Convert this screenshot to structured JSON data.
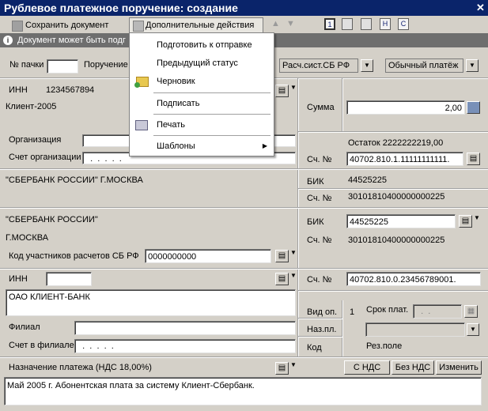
{
  "window": {
    "title": "Рублевое платежное поручение: создание",
    "close_glyph": "✕"
  },
  "toolbar": {
    "save_label": "Сохранить документ",
    "extra_label": "Дополнительные действия"
  },
  "info": {
    "text": "Документ может быть подг"
  },
  "menu": {
    "items": [
      "Подготовить к отправке",
      "Предыдущий статус",
      "Черновик",
      "Подписать",
      "Печать",
      "Шаблоны"
    ],
    "submenu_arrow": "▶"
  },
  "header": {
    "batch_label": "№ пачки",
    "batch_value": "",
    "order_label": "Поручение",
    "calc_system": "Расч.сист.СБ РФ",
    "payment_type": "Обычный платёж"
  },
  "payer": {
    "inn_label": "ИНН",
    "inn_value": "1234567894",
    "name": "Клиент-2005",
    "org_label": "Организация",
    "org_value": "",
    "account_label": "Счет организации",
    "account_value": "  .  .  .  .  ."
  },
  "amount": {
    "label": "Сумма",
    "value": "2,00"
  },
  "payer_account": {
    "label": "Сч. №",
    "balance": "Остаток 2222222219,00",
    "value": "40702.810.1.11111111111."
  },
  "payer_bank": {
    "name": "\"СБЕРБАНК РОССИИ\" Г.МОСКВА",
    "bik_label": "БИК",
    "bik_value": "44525225",
    "acc_label": "Сч. №",
    "acc_value": "30101810400000000225"
  },
  "payee_bank": {
    "name": "\"СБЕРБАНК РОССИИ\"",
    "city": "Г.МОСКВА",
    "code_label": "Код участников расчетов СБ РФ",
    "code_value": "0000000000",
    "bik_label": "БИК",
    "bik_value": "44525225",
    "acc_label": "Сч. №",
    "acc_value": "30101810400000000225"
  },
  "payee": {
    "inn_label": "ИНН",
    "inn_value": "",
    "acc_label": "Сч. №",
    "acc_value": "40702.810.0.23456789001.",
    "name": "ОАО КЛИЕНТ-БАНК",
    "branch_label": "Филиал",
    "branch_value": "",
    "branch_acc_label": "Счет в филиале",
    "branch_acc_value": "  .  .  .  .  ."
  },
  "op": {
    "type_label": "Вид оп.",
    "type_value": "1",
    "purpose_label": "Наз.пл.",
    "code_label": "Код",
    "term_label": "Срок плат.",
    "term_value": "  .  .",
    "res_label": "Рез.поле"
  },
  "purpose": {
    "label": "Назначение платежа (НДС 18,00%)",
    "btn_vat": "С НДС",
    "btn_novat": "Без НДС",
    "btn_change": "Изменить",
    "text": "Май 2005 г. Абонентская плата за систему Клиент-Сбербанк."
  },
  "icons": {
    "calc": "calculator-icon",
    "book": "directory-book-icon"
  }
}
